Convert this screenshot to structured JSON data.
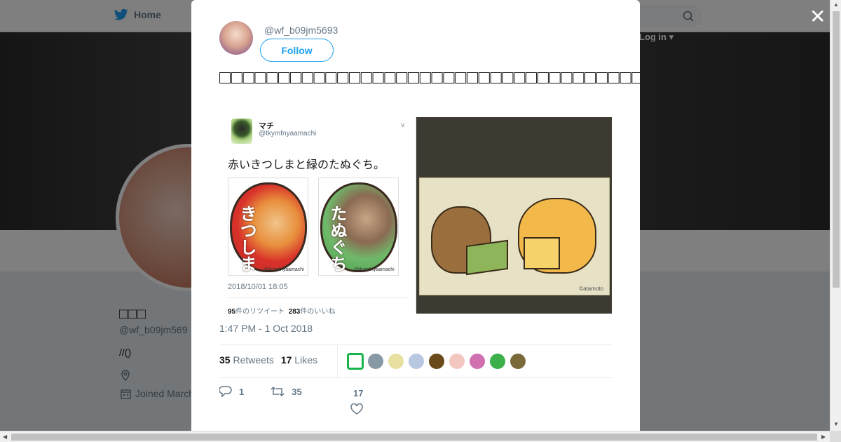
{
  "nav": {
    "home_label": "Home",
    "login_label": "Log in"
  },
  "profile": {
    "name": "□□□",
    "handle": "@wf_b09jm569",
    "bio": "//()",
    "joined": "Joined March"
  },
  "tweet": {
    "handle": "@wf_b09jm5693",
    "follow_label": "Follow",
    "text": "□□□□□□□□□□□□□□□□□□□□□□□□□□□□□□□□□□□□□□□□□□□□□□□□□",
    "timestamp": "1:47 PM - 1 Oct 2018",
    "retweets_count": "35",
    "retweets_label": "Retweets",
    "likes_count": "17",
    "likes_label": "Likes",
    "reply_count": "1",
    "retweet_action_count": "35",
    "like_action_count": "17"
  },
  "embedded": {
    "name": "マチ",
    "handle": "@tkymfnyaamachi",
    "text": "赤いきつしまと緑のたぬぐち。",
    "sticker1_word": "きつしま",
    "sticker2_word": "たぬぐち",
    "sticker_tag": "@tkymfnyaamachi",
    "date": "2018/10/01 18:05",
    "rt_count": "95",
    "rt_label": "件のリツイート",
    "like_count": "283",
    "like_label": "件のいいね"
  },
  "image_credit": "©atamoto",
  "liker_colors": [
    "#18b34a",
    "#8899a6",
    "#e8e0a0",
    "#b8c8e0",
    "#6b4a1a",
    "#f3c7c0",
    "#d070b0",
    "#3cb04a",
    "#7a6a3a"
  ],
  "colors": {
    "accent": "#1da1f2",
    "muted": "#657786"
  }
}
